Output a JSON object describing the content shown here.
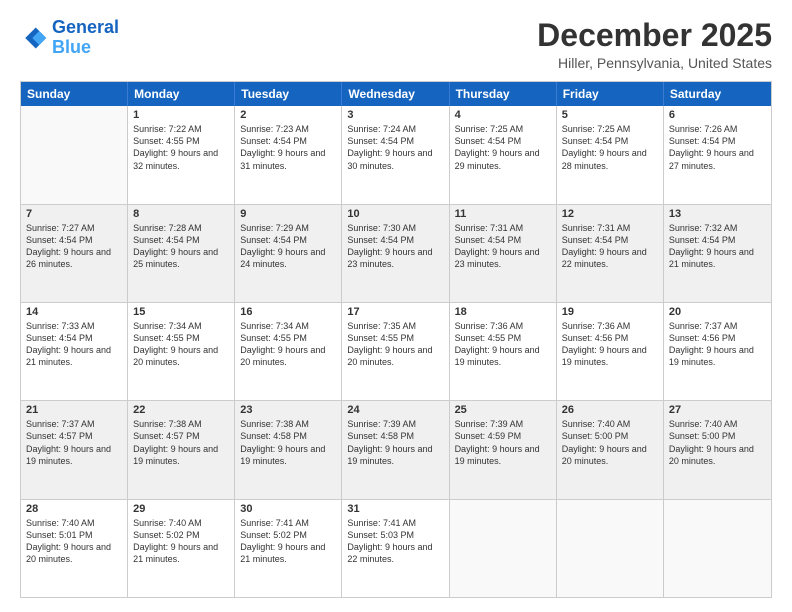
{
  "logo": {
    "line1": "General",
    "line2": "Blue"
  },
  "title": {
    "month_year": "December 2025",
    "location": "Hiller, Pennsylvania, United States"
  },
  "header_days": [
    "Sunday",
    "Monday",
    "Tuesday",
    "Wednesday",
    "Thursday",
    "Friday",
    "Saturday"
  ],
  "rows": [
    [
      {
        "day": "",
        "sunrise": "",
        "sunset": "",
        "daylight": "",
        "empty": true
      },
      {
        "day": "1",
        "sunrise": "Sunrise: 7:22 AM",
        "sunset": "Sunset: 4:55 PM",
        "daylight": "Daylight: 9 hours and 32 minutes."
      },
      {
        "day": "2",
        "sunrise": "Sunrise: 7:23 AM",
        "sunset": "Sunset: 4:54 PM",
        "daylight": "Daylight: 9 hours and 31 minutes."
      },
      {
        "day": "3",
        "sunrise": "Sunrise: 7:24 AM",
        "sunset": "Sunset: 4:54 PM",
        "daylight": "Daylight: 9 hours and 30 minutes."
      },
      {
        "day": "4",
        "sunrise": "Sunrise: 7:25 AM",
        "sunset": "Sunset: 4:54 PM",
        "daylight": "Daylight: 9 hours and 29 minutes."
      },
      {
        "day": "5",
        "sunrise": "Sunrise: 7:25 AM",
        "sunset": "Sunset: 4:54 PM",
        "daylight": "Daylight: 9 hours and 28 minutes."
      },
      {
        "day": "6",
        "sunrise": "Sunrise: 7:26 AM",
        "sunset": "Sunset: 4:54 PM",
        "daylight": "Daylight: 9 hours and 27 minutes."
      }
    ],
    [
      {
        "day": "7",
        "sunrise": "Sunrise: 7:27 AM",
        "sunset": "Sunset: 4:54 PM",
        "daylight": "Daylight: 9 hours and 26 minutes."
      },
      {
        "day": "8",
        "sunrise": "Sunrise: 7:28 AM",
        "sunset": "Sunset: 4:54 PM",
        "daylight": "Daylight: 9 hours and 25 minutes."
      },
      {
        "day": "9",
        "sunrise": "Sunrise: 7:29 AM",
        "sunset": "Sunset: 4:54 PM",
        "daylight": "Daylight: 9 hours and 24 minutes."
      },
      {
        "day": "10",
        "sunrise": "Sunrise: 7:30 AM",
        "sunset": "Sunset: 4:54 PM",
        "daylight": "Daylight: 9 hours and 23 minutes."
      },
      {
        "day": "11",
        "sunrise": "Sunrise: 7:31 AM",
        "sunset": "Sunset: 4:54 PM",
        "daylight": "Daylight: 9 hours and 23 minutes."
      },
      {
        "day": "12",
        "sunrise": "Sunrise: 7:31 AM",
        "sunset": "Sunset: 4:54 PM",
        "daylight": "Daylight: 9 hours and 22 minutes."
      },
      {
        "day": "13",
        "sunrise": "Sunrise: 7:32 AM",
        "sunset": "Sunset: 4:54 PM",
        "daylight": "Daylight: 9 hours and 21 minutes."
      }
    ],
    [
      {
        "day": "14",
        "sunrise": "Sunrise: 7:33 AM",
        "sunset": "Sunset: 4:54 PM",
        "daylight": "Daylight: 9 hours and 21 minutes."
      },
      {
        "day": "15",
        "sunrise": "Sunrise: 7:34 AM",
        "sunset": "Sunset: 4:55 PM",
        "daylight": "Daylight: 9 hours and 20 minutes."
      },
      {
        "day": "16",
        "sunrise": "Sunrise: 7:34 AM",
        "sunset": "Sunset: 4:55 PM",
        "daylight": "Daylight: 9 hours and 20 minutes."
      },
      {
        "day": "17",
        "sunrise": "Sunrise: 7:35 AM",
        "sunset": "Sunset: 4:55 PM",
        "daylight": "Daylight: 9 hours and 20 minutes."
      },
      {
        "day": "18",
        "sunrise": "Sunrise: 7:36 AM",
        "sunset": "Sunset: 4:55 PM",
        "daylight": "Daylight: 9 hours and 19 minutes."
      },
      {
        "day": "19",
        "sunrise": "Sunrise: 7:36 AM",
        "sunset": "Sunset: 4:56 PM",
        "daylight": "Daylight: 9 hours and 19 minutes."
      },
      {
        "day": "20",
        "sunrise": "Sunrise: 7:37 AM",
        "sunset": "Sunset: 4:56 PM",
        "daylight": "Daylight: 9 hours and 19 minutes."
      }
    ],
    [
      {
        "day": "21",
        "sunrise": "Sunrise: 7:37 AM",
        "sunset": "Sunset: 4:57 PM",
        "daylight": "Daylight: 9 hours and 19 minutes."
      },
      {
        "day": "22",
        "sunrise": "Sunrise: 7:38 AM",
        "sunset": "Sunset: 4:57 PM",
        "daylight": "Daylight: 9 hours and 19 minutes."
      },
      {
        "day": "23",
        "sunrise": "Sunrise: 7:38 AM",
        "sunset": "Sunset: 4:58 PM",
        "daylight": "Daylight: 9 hours and 19 minutes."
      },
      {
        "day": "24",
        "sunrise": "Sunrise: 7:39 AM",
        "sunset": "Sunset: 4:58 PM",
        "daylight": "Daylight: 9 hours and 19 minutes."
      },
      {
        "day": "25",
        "sunrise": "Sunrise: 7:39 AM",
        "sunset": "Sunset: 4:59 PM",
        "daylight": "Daylight: 9 hours and 19 minutes."
      },
      {
        "day": "26",
        "sunrise": "Sunrise: 7:40 AM",
        "sunset": "Sunset: 5:00 PM",
        "daylight": "Daylight: 9 hours and 20 minutes."
      },
      {
        "day": "27",
        "sunrise": "Sunrise: 7:40 AM",
        "sunset": "Sunset: 5:00 PM",
        "daylight": "Daylight: 9 hours and 20 minutes."
      }
    ],
    [
      {
        "day": "28",
        "sunrise": "Sunrise: 7:40 AM",
        "sunset": "Sunset: 5:01 PM",
        "daylight": "Daylight: 9 hours and 20 minutes."
      },
      {
        "day": "29",
        "sunrise": "Sunrise: 7:40 AM",
        "sunset": "Sunset: 5:02 PM",
        "daylight": "Daylight: 9 hours and 21 minutes."
      },
      {
        "day": "30",
        "sunrise": "Sunrise: 7:41 AM",
        "sunset": "Sunset: 5:02 PM",
        "daylight": "Daylight: 9 hours and 21 minutes."
      },
      {
        "day": "31",
        "sunrise": "Sunrise: 7:41 AM",
        "sunset": "Sunset: 5:03 PM",
        "daylight": "Daylight: 9 hours and 22 minutes."
      },
      {
        "day": "",
        "sunrise": "",
        "sunset": "",
        "daylight": "",
        "empty": true
      },
      {
        "day": "",
        "sunrise": "",
        "sunset": "",
        "daylight": "",
        "empty": true
      },
      {
        "day": "",
        "sunrise": "",
        "sunset": "",
        "daylight": "",
        "empty": true
      }
    ]
  ]
}
